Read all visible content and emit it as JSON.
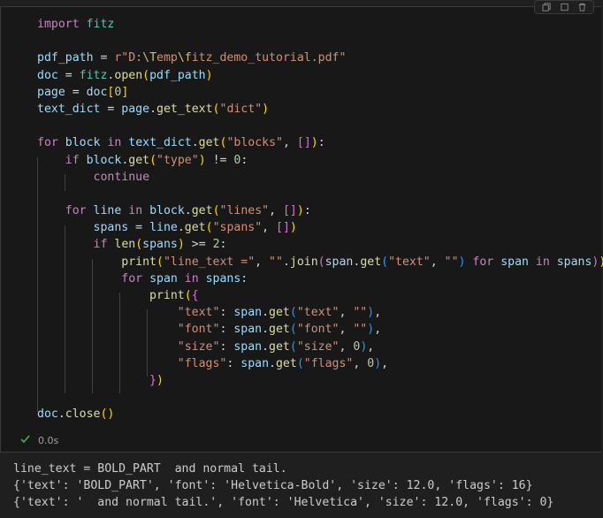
{
  "toolbar": {
    "icons": [
      "copy-icon",
      "stop-icon",
      "delete-icon"
    ]
  },
  "code_lines": [
    [
      {
        "t": "import",
        "c": "kw"
      },
      {
        "t": " ",
        "c": ""
      },
      {
        "t": "fitz",
        "c": "mod"
      }
    ],
    [],
    [
      {
        "t": "pdf_path",
        "c": "var"
      },
      {
        "t": " = ",
        "c": "op"
      },
      {
        "t": "r\"D:",
        "c": "str"
      },
      {
        "t": "\\T",
        "c": "esc"
      },
      {
        "t": "emp",
        "c": "str"
      },
      {
        "t": "\\f",
        "c": "esc"
      },
      {
        "t": "itz_demo_tutorial.pdf\"",
        "c": "str"
      }
    ],
    [
      {
        "t": "doc",
        "c": "var"
      },
      {
        "t": " = ",
        "c": "op"
      },
      {
        "t": "fitz",
        "c": "mod"
      },
      {
        "t": ".",
        "c": "op"
      },
      {
        "t": "open",
        "c": "fn"
      },
      {
        "t": "(",
        "c": "b1"
      },
      {
        "t": "pdf_path",
        "c": "var"
      },
      {
        "t": ")",
        "c": "b1"
      }
    ],
    [
      {
        "t": "page",
        "c": "var"
      },
      {
        "t": " = ",
        "c": "op"
      },
      {
        "t": "doc",
        "c": "var"
      },
      {
        "t": "[",
        "c": "b1"
      },
      {
        "t": "0",
        "c": "num"
      },
      {
        "t": "]",
        "c": "b1"
      }
    ],
    [
      {
        "t": "text_dict",
        "c": "var"
      },
      {
        "t": " = ",
        "c": "op"
      },
      {
        "t": "page",
        "c": "var"
      },
      {
        "t": ".",
        "c": "op"
      },
      {
        "t": "get_text",
        "c": "fn"
      },
      {
        "t": "(",
        "c": "b1"
      },
      {
        "t": "\"dict\"",
        "c": "str"
      },
      {
        "t": ")",
        "c": "b1"
      }
    ],
    [],
    [
      {
        "t": "for",
        "c": "kw"
      },
      {
        "t": " ",
        "c": ""
      },
      {
        "t": "block",
        "c": "var"
      },
      {
        "t": " in ",
        "c": "kw"
      },
      {
        "t": "text_dict",
        "c": "var"
      },
      {
        "t": ".",
        "c": "op"
      },
      {
        "t": "get",
        "c": "fn"
      },
      {
        "t": "(",
        "c": "b1"
      },
      {
        "t": "\"blocks\"",
        "c": "str"
      },
      {
        "t": ", ",
        "c": "op"
      },
      {
        "t": "[]",
        "c": "b2"
      },
      {
        "t": ")",
        "c": "b1"
      },
      {
        "t": ":",
        "c": "op"
      }
    ],
    [
      {
        "t": "    ",
        "c": ""
      },
      {
        "t": "if",
        "c": "kw"
      },
      {
        "t": " ",
        "c": ""
      },
      {
        "t": "block",
        "c": "var"
      },
      {
        "t": ".",
        "c": "op"
      },
      {
        "t": "get",
        "c": "fn"
      },
      {
        "t": "(",
        "c": "b1"
      },
      {
        "t": "\"type\"",
        "c": "str"
      },
      {
        "t": ")",
        "c": "b1"
      },
      {
        "t": " != ",
        "c": "op"
      },
      {
        "t": "0",
        "c": "num"
      },
      {
        "t": ":",
        "c": "op"
      }
    ],
    [
      {
        "t": "        ",
        "c": ""
      },
      {
        "t": "continue",
        "c": "kw"
      }
    ],
    [],
    [
      {
        "t": "    ",
        "c": ""
      },
      {
        "t": "for",
        "c": "kw"
      },
      {
        "t": " ",
        "c": ""
      },
      {
        "t": "line",
        "c": "var"
      },
      {
        "t": " in ",
        "c": "kw"
      },
      {
        "t": "block",
        "c": "var"
      },
      {
        "t": ".",
        "c": "op"
      },
      {
        "t": "get",
        "c": "fn"
      },
      {
        "t": "(",
        "c": "b1"
      },
      {
        "t": "\"lines\"",
        "c": "str"
      },
      {
        "t": ", ",
        "c": "op"
      },
      {
        "t": "[]",
        "c": "b2"
      },
      {
        "t": ")",
        "c": "b1"
      },
      {
        "t": ":",
        "c": "op"
      }
    ],
    [
      {
        "t": "        ",
        "c": ""
      },
      {
        "t": "spans",
        "c": "var"
      },
      {
        "t": " = ",
        "c": "op"
      },
      {
        "t": "line",
        "c": "var"
      },
      {
        "t": ".",
        "c": "op"
      },
      {
        "t": "get",
        "c": "fn"
      },
      {
        "t": "(",
        "c": "b1"
      },
      {
        "t": "\"spans\"",
        "c": "str"
      },
      {
        "t": ", ",
        "c": "op"
      },
      {
        "t": "[]",
        "c": "b2"
      },
      {
        "t": ")",
        "c": "b1"
      }
    ],
    [
      {
        "t": "        ",
        "c": ""
      },
      {
        "t": "if",
        "c": "kw"
      },
      {
        "t": " ",
        "c": ""
      },
      {
        "t": "len",
        "c": "fn"
      },
      {
        "t": "(",
        "c": "b1"
      },
      {
        "t": "spans",
        "c": "var"
      },
      {
        "t": ")",
        "c": "b1"
      },
      {
        "t": " >= ",
        "c": "op"
      },
      {
        "t": "2",
        "c": "num"
      },
      {
        "t": ":",
        "c": "op"
      }
    ],
    [
      {
        "t": "            ",
        "c": ""
      },
      {
        "t": "print",
        "c": "fn"
      },
      {
        "t": "(",
        "c": "b1"
      },
      {
        "t": "\"line_text =\"",
        "c": "str"
      },
      {
        "t": ", ",
        "c": "op"
      },
      {
        "t": "\"\"",
        "c": "str"
      },
      {
        "t": ".",
        "c": "op"
      },
      {
        "t": "join",
        "c": "fn"
      },
      {
        "t": "(",
        "c": "b2"
      },
      {
        "t": "span",
        "c": "var"
      },
      {
        "t": ".",
        "c": "op"
      },
      {
        "t": "get",
        "c": "fn"
      },
      {
        "t": "(",
        "c": "b3"
      },
      {
        "t": "\"text\"",
        "c": "str"
      },
      {
        "t": ", ",
        "c": "op"
      },
      {
        "t": "\"\"",
        "c": "str"
      },
      {
        "t": ")",
        "c": "b3"
      },
      {
        "t": " for ",
        "c": "kw"
      },
      {
        "t": "span",
        "c": "var"
      },
      {
        "t": " in ",
        "c": "kw"
      },
      {
        "t": "spans",
        "c": "var"
      },
      {
        "t": ")",
        "c": "b2"
      },
      {
        "t": ")",
        "c": "b1"
      }
    ],
    [
      {
        "t": "            ",
        "c": ""
      },
      {
        "t": "for",
        "c": "kw"
      },
      {
        "t": " ",
        "c": ""
      },
      {
        "t": "span",
        "c": "var"
      },
      {
        "t": " in ",
        "c": "kw"
      },
      {
        "t": "spans",
        "c": "var"
      },
      {
        "t": ":",
        "c": "op"
      }
    ],
    [
      {
        "t": "                ",
        "c": ""
      },
      {
        "t": "print",
        "c": "fn"
      },
      {
        "t": "(",
        "c": "b1"
      },
      {
        "t": "{",
        "c": "b2"
      }
    ],
    [
      {
        "t": "                    ",
        "c": ""
      },
      {
        "t": "\"text\"",
        "c": "str"
      },
      {
        "t": ": ",
        "c": "op"
      },
      {
        "t": "span",
        "c": "var"
      },
      {
        "t": ".",
        "c": "op"
      },
      {
        "t": "get",
        "c": "fn"
      },
      {
        "t": "(",
        "c": "b3"
      },
      {
        "t": "\"text\"",
        "c": "str"
      },
      {
        "t": ", ",
        "c": "op"
      },
      {
        "t": "\"\"",
        "c": "str"
      },
      {
        "t": ")",
        "c": "b3"
      },
      {
        "t": ",",
        "c": "op"
      }
    ],
    [
      {
        "t": "                    ",
        "c": ""
      },
      {
        "t": "\"font\"",
        "c": "str"
      },
      {
        "t": ": ",
        "c": "op"
      },
      {
        "t": "span",
        "c": "var"
      },
      {
        "t": ".",
        "c": "op"
      },
      {
        "t": "get",
        "c": "fn"
      },
      {
        "t": "(",
        "c": "b3"
      },
      {
        "t": "\"font\"",
        "c": "str"
      },
      {
        "t": ", ",
        "c": "op"
      },
      {
        "t": "\"\"",
        "c": "str"
      },
      {
        "t": ")",
        "c": "b3"
      },
      {
        "t": ",",
        "c": "op"
      }
    ],
    [
      {
        "t": "                    ",
        "c": ""
      },
      {
        "t": "\"size\"",
        "c": "str"
      },
      {
        "t": ": ",
        "c": "op"
      },
      {
        "t": "span",
        "c": "var"
      },
      {
        "t": ".",
        "c": "op"
      },
      {
        "t": "get",
        "c": "fn"
      },
      {
        "t": "(",
        "c": "b3"
      },
      {
        "t": "\"size\"",
        "c": "str"
      },
      {
        "t": ", ",
        "c": "op"
      },
      {
        "t": "0",
        "c": "num"
      },
      {
        "t": ")",
        "c": "b3"
      },
      {
        "t": ",",
        "c": "op"
      }
    ],
    [
      {
        "t": "                    ",
        "c": ""
      },
      {
        "t": "\"flags\"",
        "c": "str"
      },
      {
        "t": ": ",
        "c": "op"
      },
      {
        "t": "span",
        "c": "var"
      },
      {
        "t": ".",
        "c": "op"
      },
      {
        "t": "get",
        "c": "fn"
      },
      {
        "t": "(",
        "c": "b3"
      },
      {
        "t": "\"flags\"",
        "c": "str"
      },
      {
        "t": ", ",
        "c": "op"
      },
      {
        "t": "0",
        "c": "num"
      },
      {
        "t": ")",
        "c": "b3"
      },
      {
        "t": ",",
        "c": "op"
      }
    ],
    [
      {
        "t": "                ",
        "c": ""
      },
      {
        "t": "}",
        "c": "b2"
      },
      {
        "t": ")",
        "c": "b1"
      }
    ],
    [],
    [
      {
        "t": "doc",
        "c": "var"
      },
      {
        "t": ".",
        "c": "op"
      },
      {
        "t": "close",
        "c": "fn"
      },
      {
        "t": "()",
        "c": "b1"
      }
    ]
  ],
  "execution": {
    "duration": "0.0s",
    "status_icon": "check-icon",
    "status_color": "#4caf50"
  },
  "output_lines": [
    "line_text = BOLD_PART  and normal tail.",
    "{'text': 'BOLD_PART', 'font': 'Helvetica-Bold', 'size': 12.0, 'flags': 16}",
    "{'text': '  and normal tail.', 'font': 'Helvetica', 'size': 12.0, 'flags': 0}"
  ]
}
